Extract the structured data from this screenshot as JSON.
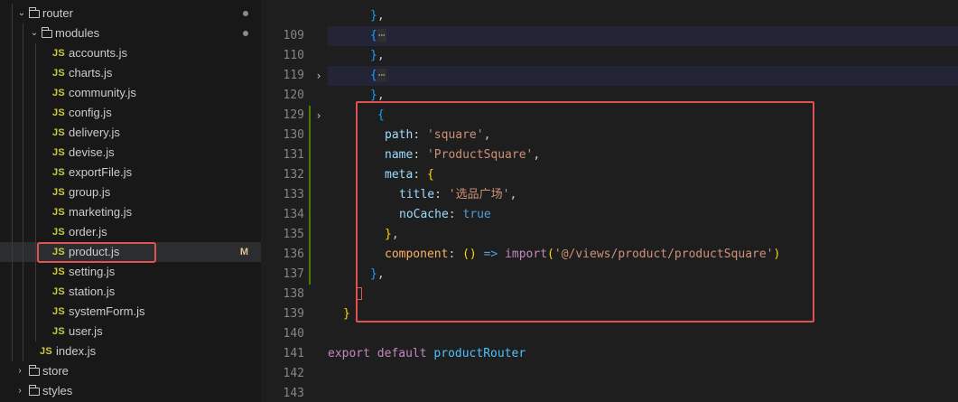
{
  "explorer": {
    "folders": {
      "router": "router",
      "modules": "modules",
      "store": "store",
      "styles": "styles"
    },
    "file_icon_label": "JS",
    "files": [
      "accounts.js",
      "charts.js",
      "community.js",
      "config.js",
      "delivery.js",
      "devise.js",
      "exportFile.js",
      "group.js",
      "marketing.js",
      "order.js",
      "product.js",
      "setting.js",
      "station.js",
      "systemForm.js",
      "user.js"
    ],
    "index_file": "index.js",
    "modified_badge": "M",
    "icons": {
      "folder_open": "folder-open-icon",
      "folder_closed": "folder-icon",
      "chevron_down": "chevron-down-icon",
      "chevron_right": "chevron-right-icon"
    }
  },
  "editor": {
    "line_numbers": {
      "l109": "109",
      "l110": "110",
      "l119": "119",
      "l120": "120",
      "l129": "129",
      "l130": "130",
      "l131": "131",
      "l132": "132",
      "l133": "133",
      "l134": "134",
      "l135": "135",
      "l136": "136",
      "l137": "137",
      "l138": "138",
      "l139": "139",
      "l140": "140",
      "l141": "141",
      "l142": "142",
      "l143": "143"
    },
    "tokens": {
      "close_brace": "}",
      "comma": ",",
      "open_brace": "{",
      "ellipsis": "⋯",
      "colon": ":",
      "path_key": "path",
      "path_val": "'square'",
      "name_key": "name",
      "name_val": "'ProductSquare'",
      "meta_key": "meta",
      "title_key": "title",
      "title_val": "'选品广场'",
      "nocache_key": "noCache",
      "nocache_val": "true",
      "component_key": "component",
      "paren_pair": "()",
      "arrow": "=>",
      "import_fn": "import",
      "open_paren": "(",
      "close_paren": ")",
      "import_path": "'@/views/product/productSquare'",
      "kw_export": "export",
      "kw_default": "default",
      "router_var": "productRouter"
    },
    "colors": {
      "annotation": "#e05252",
      "string": "#ce9178",
      "keyword": "#c586c0"
    }
  }
}
